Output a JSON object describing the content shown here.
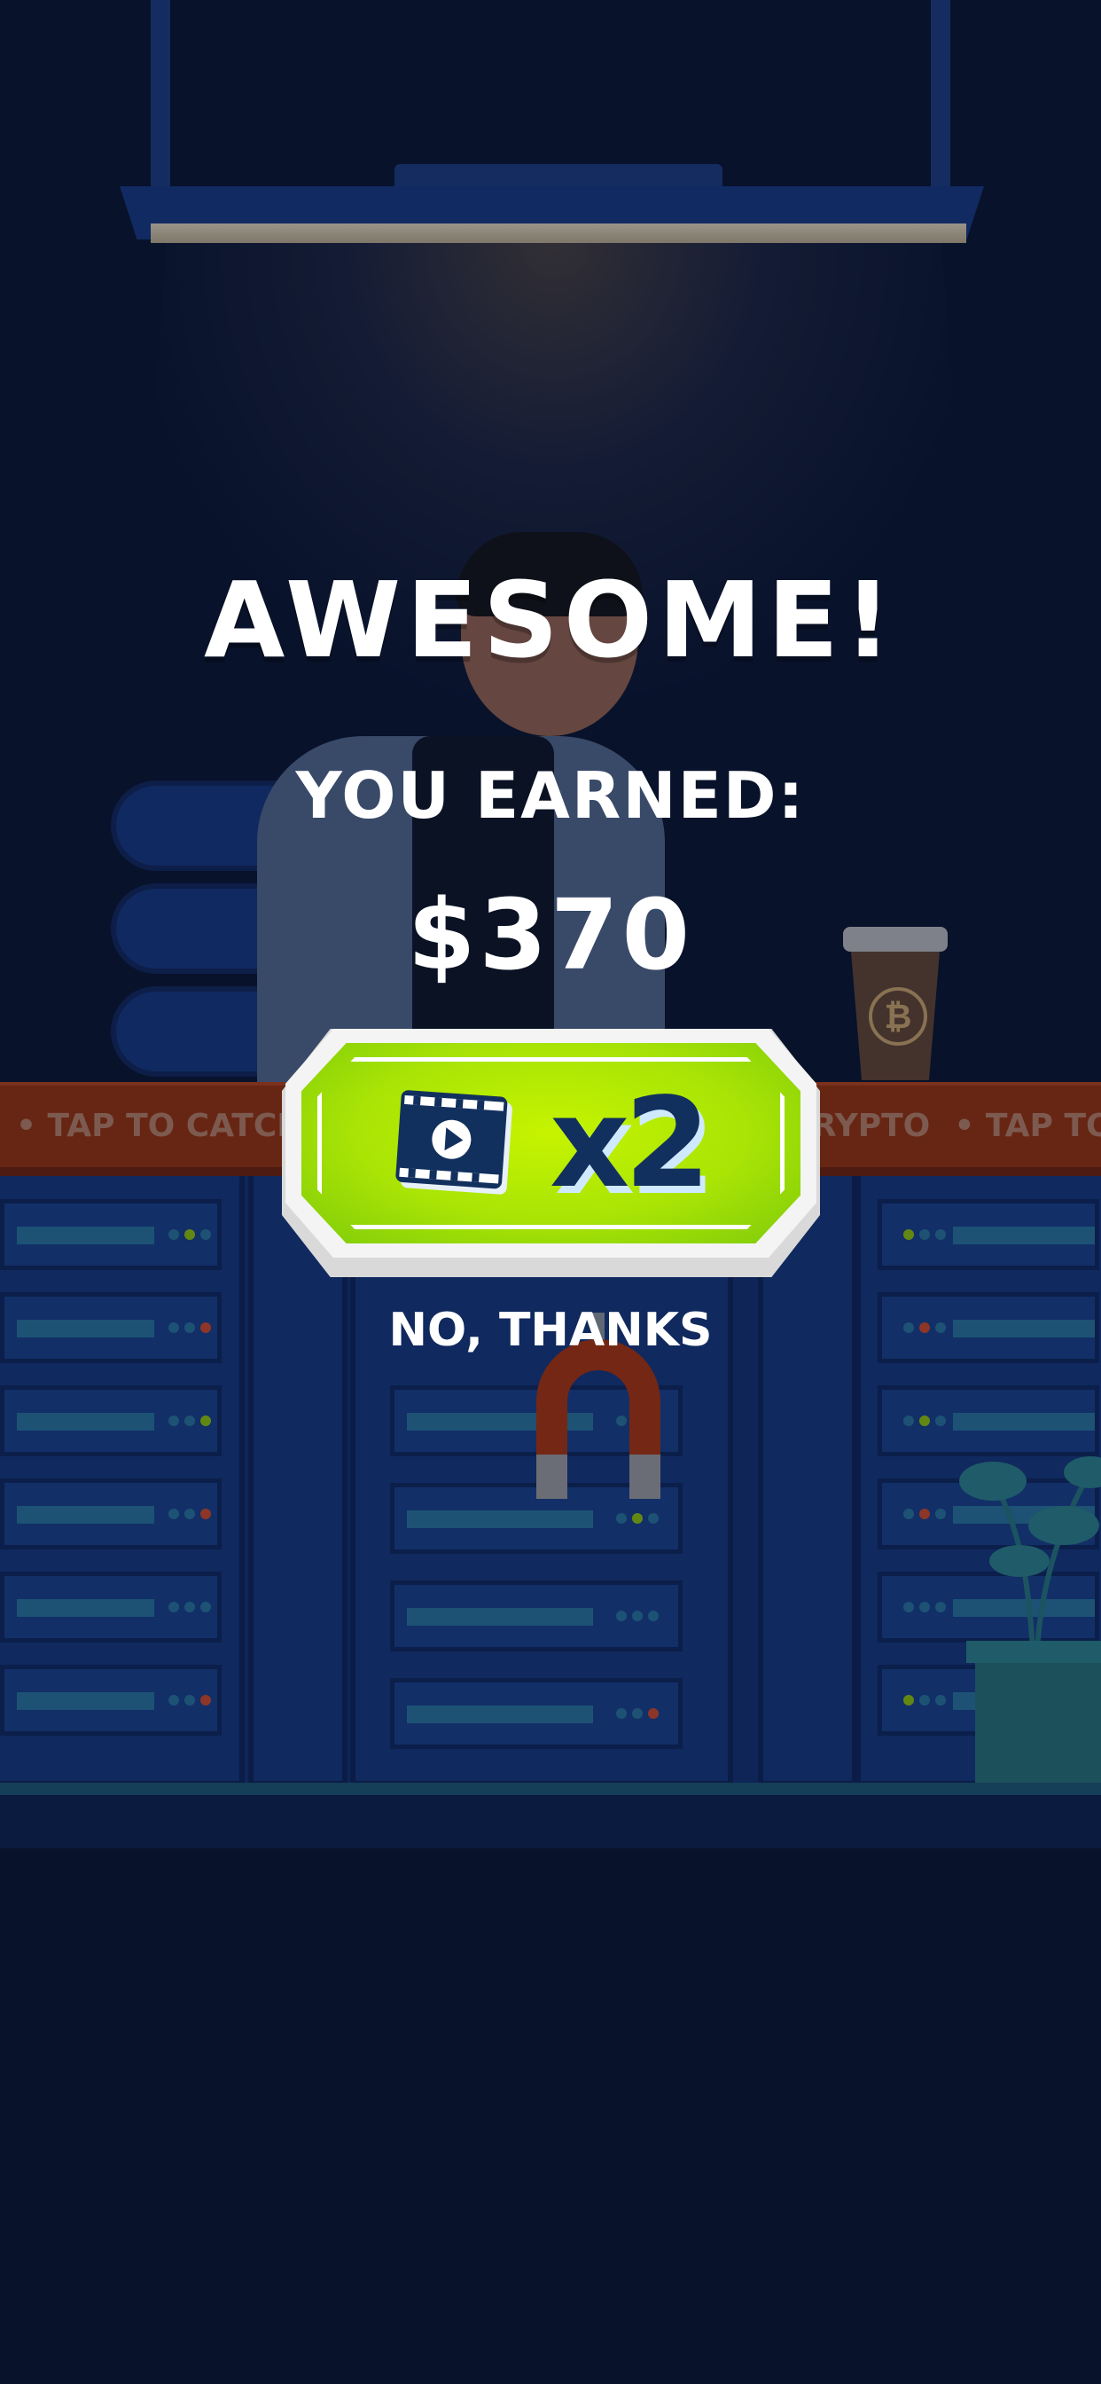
{
  "screen": {
    "headline": "AWESOME!",
    "earned_label": "YOU EARNED:",
    "earned_amount": "$370",
    "multiplier_button": {
      "label": "x2",
      "icon": "video-play-icon",
      "colors": {
        "fill": "#b5ea04",
        "text": "#12305e"
      }
    },
    "decline_label": "NO, THANKS"
  },
  "scene": {
    "ticker_text": [
      "• TAP TO CATCH",
      "CRYPTO",
      "• TAP TO CA"
    ],
    "cup_icon": "bitcoin-icon"
  }
}
